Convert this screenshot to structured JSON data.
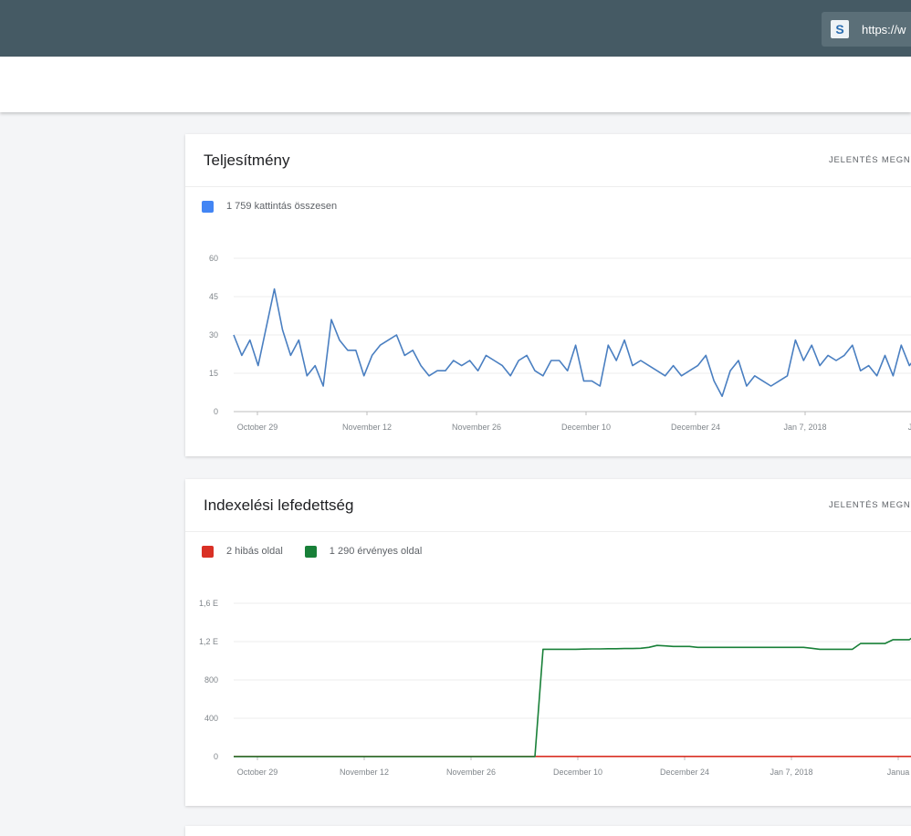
{
  "header": {
    "property_url": "https://w",
    "property_logo": "S",
    "colors": {
      "bar": "#455a64",
      "chip": "#5b6f78"
    }
  },
  "performance": {
    "title": "Teljesítmény",
    "link": "JELENTÉS MEGNYITÁSA",
    "legend_clicks": "1 759 kattintás összesen",
    "chart_data": {
      "type": "line",
      "x_tick_labels": [
        "October 29",
        "November 12",
        "November 26",
        "December 10",
        "December 24",
        "Jan 7, 2018",
        "Jan"
      ],
      "y_tick_labels": [
        "0",
        "15",
        "30",
        "45",
        "60"
      ],
      "ylim": [
        0,
        60
      ],
      "series": [
        {
          "name": "1 759 kattintás összesen",
          "color": "#4a7fc1",
          "values": [
            30,
            22,
            28,
            18,
            33,
            48,
            32,
            22,
            28,
            14,
            18,
            10,
            36,
            28,
            24,
            24,
            14,
            22,
            26,
            28,
            30,
            22,
            24,
            18,
            14,
            16,
            16,
            20,
            18,
            20,
            16,
            22,
            20,
            18,
            14,
            20,
            22,
            16,
            14,
            20,
            20,
            16,
            26,
            12,
            12,
            10,
            26,
            20,
            28,
            18,
            20,
            18,
            16,
            14,
            18,
            14,
            16,
            18,
            22,
            12,
            6,
            16,
            20,
            10,
            14,
            12,
            10,
            12,
            14,
            28,
            20,
            26,
            18,
            22,
            20,
            22,
            26,
            16,
            18,
            14,
            22,
            14,
            26,
            18,
            22,
            20,
            20
          ]
        }
      ]
    }
  },
  "indexing": {
    "title": "Indexelési lefedettség",
    "link": "JELENTÉS MEGNYITÁSA",
    "legend_errors": "2 hibás oldal",
    "legend_valid": "1 290 érvényes oldal",
    "chart_data": {
      "type": "line",
      "x_tick_labels": [
        "October 29",
        "November 12",
        "November 26",
        "December 10",
        "December 24",
        "Jan 7, 2018",
        "Janua"
      ],
      "y_tick_labels": [
        "0",
        "400",
        "800",
        "1,2 E",
        "1,6 E"
      ],
      "ylim": [
        0,
        1600
      ],
      "series": [
        {
          "name": "2 hibás oldal",
          "color": "#d93025",
          "values": [
            2,
            2,
            2,
            2,
            2,
            2,
            2,
            2,
            2,
            2,
            2,
            2,
            2,
            2,
            2,
            2,
            2,
            2,
            2,
            2,
            2,
            2,
            2,
            2,
            2,
            2,
            2,
            2,
            2,
            2,
            2,
            2,
            2,
            2,
            2,
            2,
            2,
            2,
            2,
            2,
            2,
            2,
            2,
            2,
            2,
            2,
            2,
            2,
            2,
            2,
            2,
            2,
            2,
            2,
            2,
            2,
            2,
            2,
            2,
            2,
            2,
            2,
            2,
            2,
            2,
            2,
            2,
            2,
            2,
            2,
            2,
            2,
            2,
            2,
            2,
            2,
            2,
            2,
            2,
            2,
            2,
            2,
            2,
            2,
            2,
            2,
            2
          ]
        },
        {
          "name": "1 290 érvényes oldal",
          "color": "#188038",
          "values": [
            0,
            0,
            0,
            0,
            0,
            0,
            0,
            0,
            0,
            0,
            0,
            0,
            0,
            0,
            0,
            0,
            0,
            0,
            0,
            0,
            0,
            0,
            0,
            0,
            0,
            0,
            0,
            0,
            0,
            0,
            0,
            0,
            0,
            0,
            0,
            0,
            0,
            0,
            1120,
            1120,
            1120,
            1120,
            1120,
            1122,
            1124,
            1124,
            1126,
            1126,
            1128,
            1128,
            1130,
            1140,
            1160,
            1155,
            1150,
            1150,
            1150,
            1140,
            1140,
            1140,
            1140,
            1140,
            1140,
            1140,
            1140,
            1140,
            1140,
            1140,
            1140,
            1140,
            1140,
            1130,
            1120,
            1120,
            1120,
            1120,
            1120,
            1180,
            1180,
            1180,
            1180,
            1220,
            1220,
            1220,
            1280,
            1290,
            1290
          ]
        }
      ]
    }
  }
}
